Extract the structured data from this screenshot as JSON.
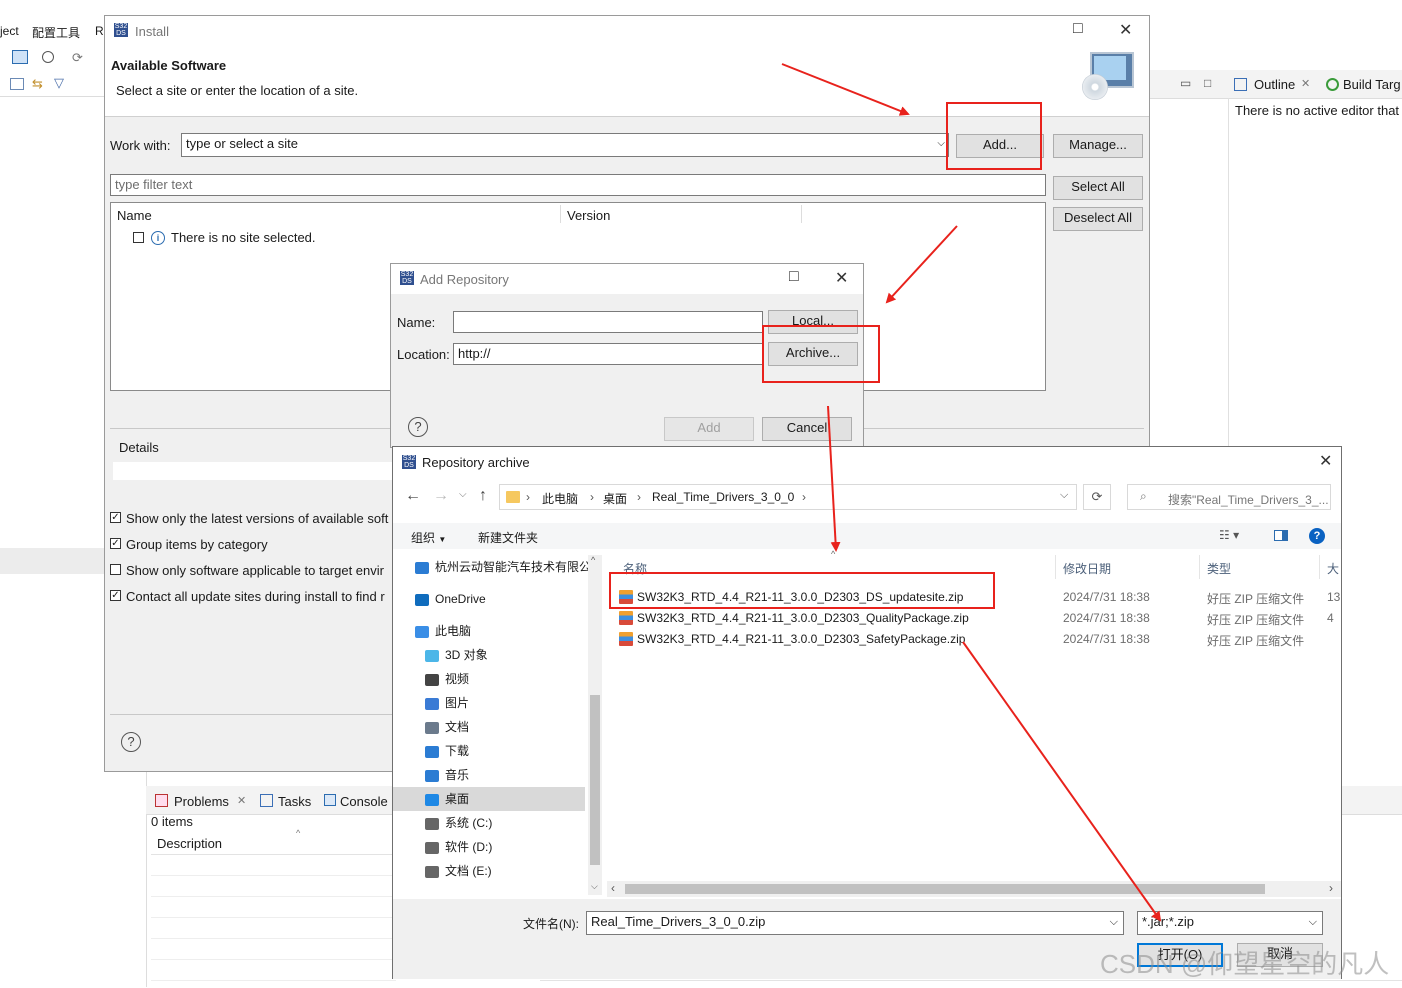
{
  "ide": {
    "menu": [
      "ject",
      "配置工具",
      "R"
    ],
    "right_tabs": [
      "Outline",
      "Build Targ"
    ],
    "right_message": "There is no active editor that",
    "bottom_tabs": [
      "Problems",
      "Tasks",
      "Console"
    ],
    "items_count": "0 items",
    "description_header": "Description"
  },
  "install": {
    "title": "Install",
    "heading": "Available Software",
    "subheading": "Select a site or enter the location of a site.",
    "work_with_label": "Work with:",
    "work_with_value": "type or select a site",
    "add_btn": "Add...",
    "manage_btn": "Manage...",
    "filter_placeholder": "type filter text",
    "select_all": "Select All",
    "deselect_all": "Deselect All",
    "col_name": "Name",
    "col_version": "Version",
    "no_site": "There is no site selected.",
    "details_label": "Details",
    "options": [
      {
        "label": "Show only the latest versions of available soft",
        "checked": true
      },
      {
        "label": "Group items by category",
        "checked": true
      },
      {
        "label": "Show only software applicable to target envir",
        "checked": false
      },
      {
        "label": "Contact all update sites during install to find r",
        "checked": true
      }
    ]
  },
  "add_repo": {
    "title": "Add Repository",
    "name_label": "Name:",
    "name_value": "",
    "location_label": "Location:",
    "location_value": "http://",
    "local_btn": "Local...",
    "archive_btn": "Archive...",
    "add_btn": "Add",
    "cancel_btn": "Cancel"
  },
  "archive": {
    "title": "Repository archive",
    "breadcrumb": [
      "此电脑",
      "桌面",
      "Real_Time_Drivers_3_0_0"
    ],
    "search_placeholder": "搜索\"Real_Time_Drivers_3_...",
    "organize": "组织",
    "new_folder": "新建文件夹",
    "nav": [
      {
        "label": "杭州云动智能汽车技术有限公",
        "icon": "cloud-folder-icon",
        "color": "#2b7cd3",
        "indent": 0
      },
      {
        "label": "OneDrive",
        "icon": "onedrive-icon",
        "color": "#0f6cbd",
        "indent": 0
      },
      {
        "label": "此电脑",
        "icon": "pc-icon",
        "color": "#3a8ee6",
        "indent": 0
      },
      {
        "label": "3D 对象",
        "icon": "3d-objects-icon",
        "color": "#4cb6e8",
        "indent": 1
      },
      {
        "label": "视频",
        "icon": "video-icon",
        "color": "#444444",
        "indent": 1
      },
      {
        "label": "图片",
        "icon": "pictures-icon",
        "color": "#3a7bd5",
        "indent": 1
      },
      {
        "label": "文档",
        "icon": "documents-icon",
        "color": "#6b7a8c",
        "indent": 1
      },
      {
        "label": "下载",
        "icon": "download-icon",
        "color": "#2b7cd3",
        "indent": 1
      },
      {
        "label": "音乐",
        "icon": "music-icon",
        "color": "#2b7cd3",
        "indent": 1
      },
      {
        "label": "桌面",
        "icon": "desktop-icon",
        "color": "#1e88e5",
        "indent": 1
      },
      {
        "label": "系统 (C:)",
        "icon": "drive-c-icon",
        "color": "#666666",
        "indent": 1
      },
      {
        "label": "软件 (D:)",
        "icon": "drive-d-icon",
        "color": "#666666",
        "indent": 1
      },
      {
        "label": "文档 (E:)",
        "icon": "drive-e-icon",
        "color": "#666666",
        "indent": 1
      }
    ],
    "columns": [
      "名称",
      "修改日期",
      "类型",
      "大"
    ],
    "files": [
      {
        "name": "SW32K3_RTD_4.4_R21-11_3.0.0_D2303_DS_updatesite.zip",
        "date": "2024/7/31 18:38",
        "type": "好压 ZIP 压缩文件",
        "size": "13"
      },
      {
        "name": "SW32K3_RTD_4.4_R21-11_3.0.0_D2303_QualityPackage.zip",
        "date": "2024/7/31 18:38",
        "type": "好压 ZIP 压缩文件",
        "size": "4"
      },
      {
        "name": "SW32K3_RTD_4.4_R21-11_3.0.0_D2303_SafetyPackage.zip",
        "date": "2024/7/31 18:38",
        "type": "好压 ZIP 压缩文件",
        "size": ""
      }
    ],
    "filename_label": "文件名(N):",
    "filename_value": "Real_Time_Drivers_3_0_0.zip",
    "filter_value": "*.jar;*.zip",
    "open_btn": "打开(O)",
    "cancel_btn": "取消"
  },
  "watermark": "CSDN @仰望星空的凡人",
  "colors": {
    "annotation_red": "#e8221c",
    "accent_blue": "#0078d7"
  }
}
